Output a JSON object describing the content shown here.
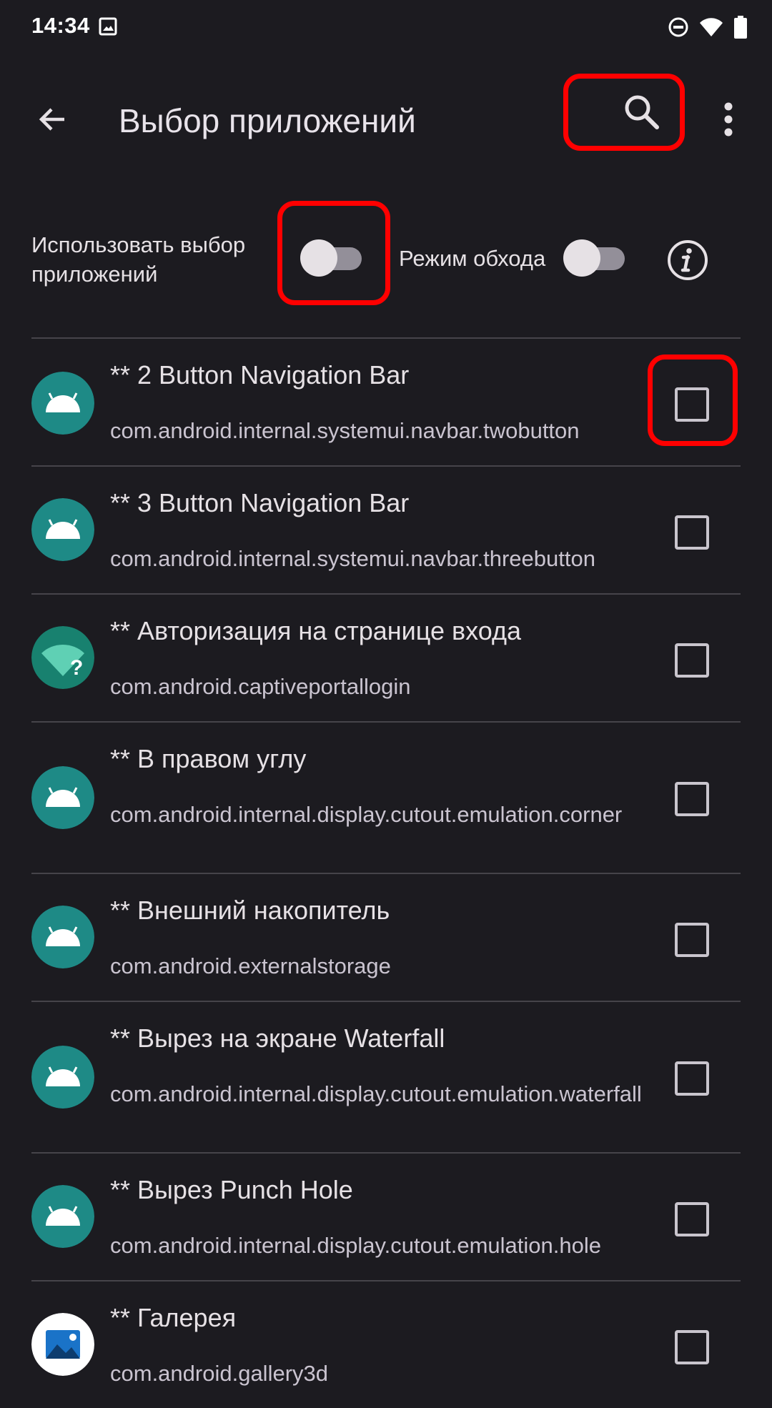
{
  "status_bar": {
    "time": "14:34",
    "icons": [
      "image-icon",
      "do-not-disturb-icon",
      "wifi-icon",
      "battery-icon"
    ]
  },
  "app_bar": {
    "title": "Выбор приложений",
    "back_icon": "arrow-back-icon",
    "search_icon": "search-icon",
    "more_icon": "more-vert-icon"
  },
  "filters": {
    "use_selection_label": "Использовать выбор приложений",
    "use_selection_on": false,
    "bypass_label": "Режим обхода",
    "bypass_on": false,
    "info_icon": "info-icon"
  },
  "apps": [
    {
      "name": "** 2 Button Navigation Bar",
      "package": "com.android.internal.systemui.navbar.twobutton",
      "icon": "android-icon",
      "checked": false
    },
    {
      "name": "** 3 Button Navigation Bar",
      "package": "com.android.internal.systemui.navbar.threebutton",
      "icon": "android-icon",
      "checked": false
    },
    {
      "name": "** Авторизация на странице входа",
      "package": "com.android.captiveportallogin",
      "icon": "wifi-question-icon",
      "checked": false
    },
    {
      "name": "** В правом углу",
      "package": "com.android.internal.display.cutout.emulation.corner",
      "icon": "android-icon",
      "checked": false
    },
    {
      "name": "** Внешний накопитель",
      "package": "com.android.externalstorage",
      "icon": "android-icon",
      "checked": false
    },
    {
      "name": "** Вырез на экране Waterfall",
      "package": "com.android.internal.display.cutout.emulation.waterfall",
      "icon": "android-icon",
      "checked": false
    },
    {
      "name": "** Вырез Punch Hole",
      "package": "com.android.internal.display.cutout.emulation.hole",
      "icon": "android-icon",
      "checked": false
    },
    {
      "name": "** Галерея",
      "package": "com.android.gallery3d",
      "icon": "gallery-icon",
      "checked": false
    }
  ],
  "colors": {
    "background": "#1c1b20",
    "highlight": "#ff0000",
    "android_teal": "#1e8a86"
  }
}
